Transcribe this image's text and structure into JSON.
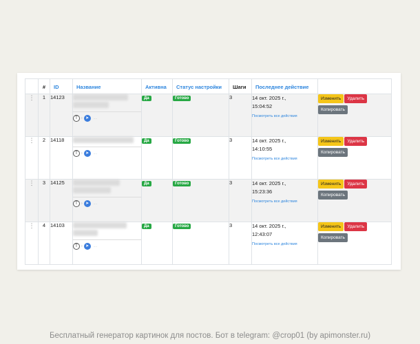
{
  "table": {
    "headers": {
      "hash": "#",
      "id": "ID",
      "name": "Название",
      "active": "Активна",
      "status": "Статус настройки",
      "steps": "Шаги",
      "last": "Последнее действие"
    },
    "rows": [
      {
        "drag": "⋮",
        "num": "1",
        "id": "14123",
        "active": "Да",
        "status": "Готово",
        "steps": "3",
        "date": "14 окт. 2025 г.,",
        "time": "15:04:52",
        "link": "Посмотреть все действия"
      },
      {
        "drag": "⋮",
        "num": "2",
        "id": "14118",
        "active": "Да",
        "status": "Готово",
        "steps": "3",
        "date": "14 окт. 2025 г.,",
        "time": "14:10:55",
        "link": "Посмотреть все действия"
      },
      {
        "drag": "⋮",
        "num": "3",
        "id": "14125",
        "active": "Да",
        "status": "Готово",
        "steps": "3",
        "date": "14 окт. 2025 г.,",
        "time": "15:23:36",
        "link": "Посмотреть все действия"
      },
      {
        "drag": "⋮",
        "num": "4",
        "id": "14103",
        "active": "Да",
        "status": "Готово",
        "steps": "3",
        "date": "14 окт. 2025 г.,",
        "time": "12:43:07",
        "link": "Посмотреть все действия"
      }
    ],
    "actions": {
      "edit": "Изменить",
      "delete": "Удалить",
      "copy": "Копировать"
    }
  },
  "icons": {
    "drag": "drag-handle-icon",
    "source": "source-round-icon",
    "telegram": "telegram-icon"
  },
  "colors": {
    "accent": "#2e86de",
    "badge": "#27a844",
    "edit": "#f5c518",
    "delete": "#dc3545",
    "copy": "#6c757d"
  },
  "footer": "Бесплатный генератор картинок для постов. Бот в telegram: @crop01 (by apimonster.ru)"
}
